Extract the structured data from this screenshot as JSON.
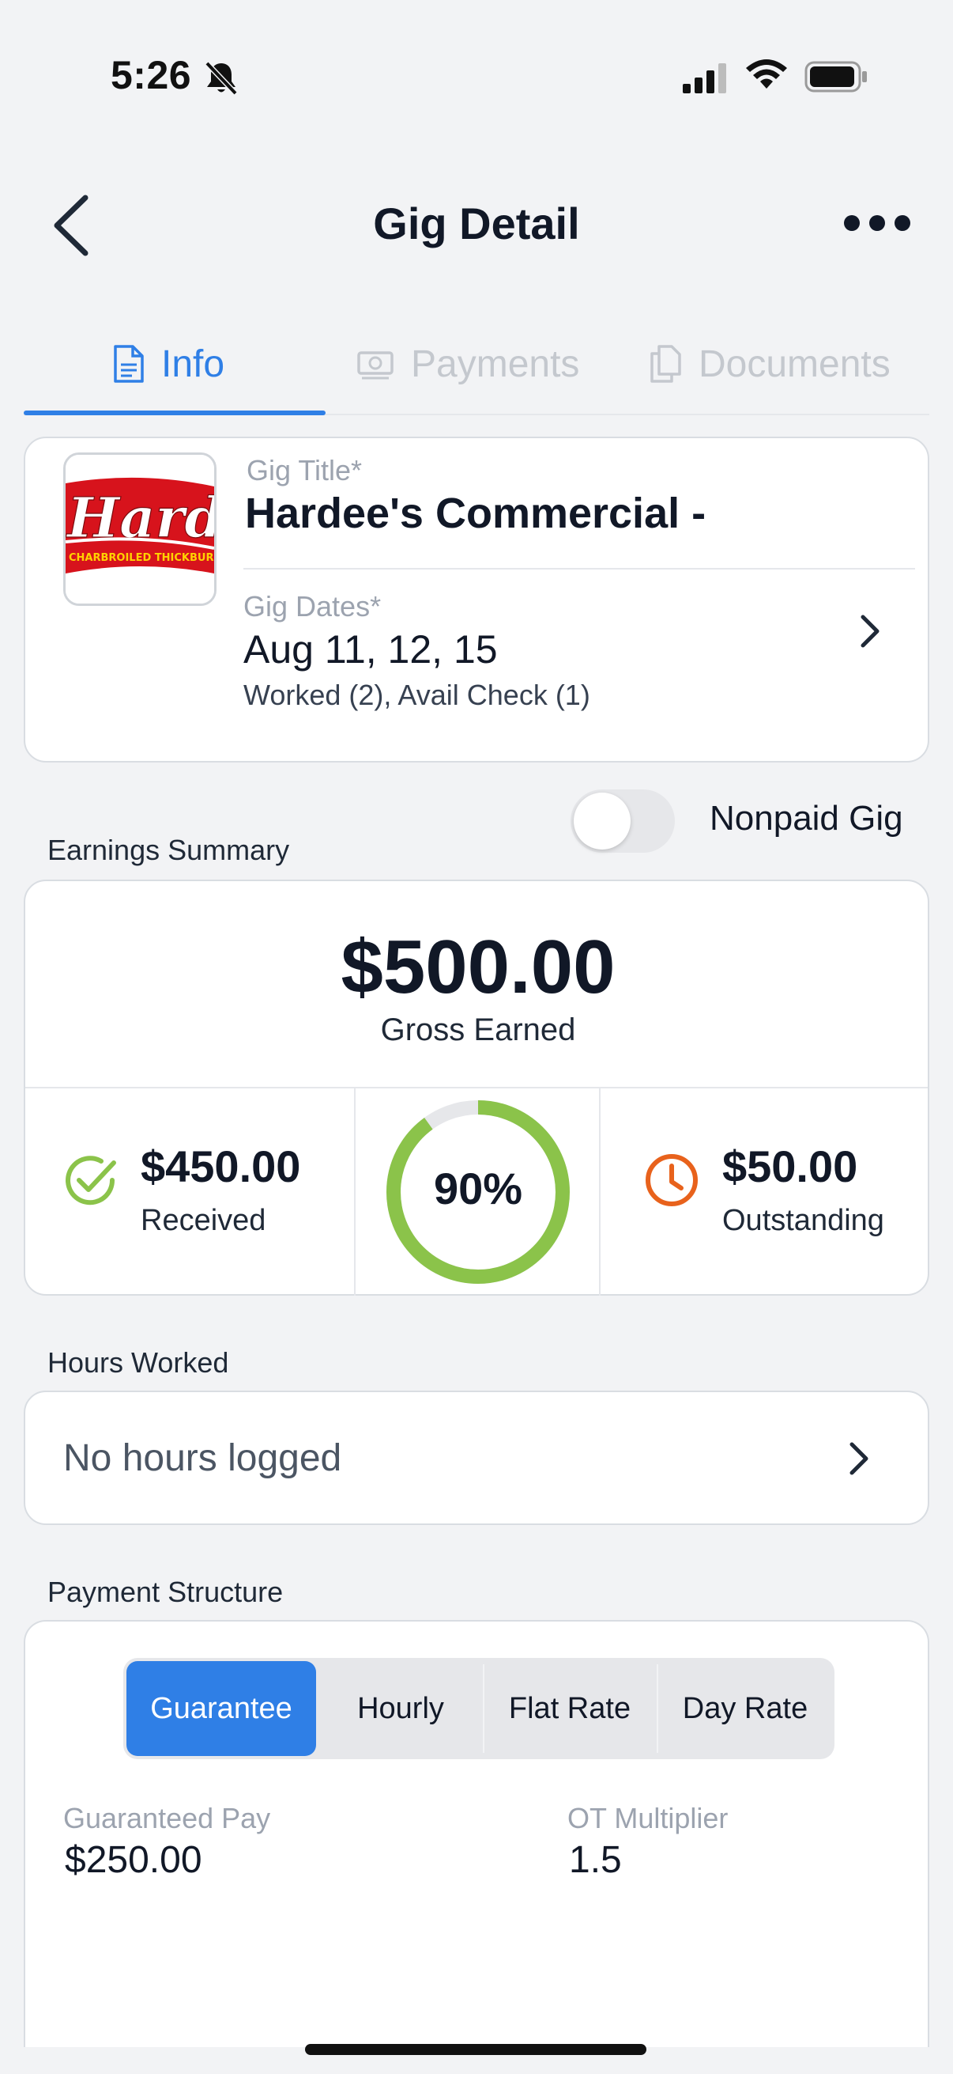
{
  "status": {
    "time": "5:26"
  },
  "header": {
    "title": "Gig Detail"
  },
  "tabs": [
    {
      "label": "Info",
      "icon": "document-icon",
      "active": true
    },
    {
      "label": "Payments",
      "icon": "money-icon",
      "active": false
    },
    {
      "label": "Documents",
      "icon": "files-icon",
      "active": false
    }
  ],
  "gig": {
    "logo_text": "Hardee",
    "logo_tagline": "CHARBROILED THICKBURGERS",
    "title_label": "Gig Title*",
    "title": "Hardee's Commercial -",
    "dates_label": "Gig Dates*",
    "dates": "Aug 11, 12, 15",
    "dates_sub": "Worked (2), Avail Check (1)"
  },
  "nonpaid": {
    "label": "Nonpaid Gig",
    "on": false
  },
  "earnings": {
    "section_label": "Earnings Summary",
    "gross_amount": "$500.00",
    "gross_label": "Gross Earned",
    "received_amount": "$450.00",
    "received_label": "Received",
    "percent": 90,
    "percent_text": "90%",
    "outstanding_amount": "$50.00",
    "outstanding_label": "Outstanding"
  },
  "hours": {
    "section_label": "Hours Worked",
    "text": "No hours logged"
  },
  "payment": {
    "section_label": "Payment Structure",
    "options": [
      "Guarantee",
      "Hourly",
      "Flat Rate",
      "Day Rate"
    ],
    "selected": "Guarantee",
    "guaranteed_label": "Guaranteed Pay",
    "guaranteed_value": "$250.00",
    "ot_label": "OT Multiplier",
    "ot_value": "1.5"
  },
  "colors": {
    "accent": "#2f7fe6",
    "received": "#8bc34a",
    "outstanding": "#e8621c"
  }
}
